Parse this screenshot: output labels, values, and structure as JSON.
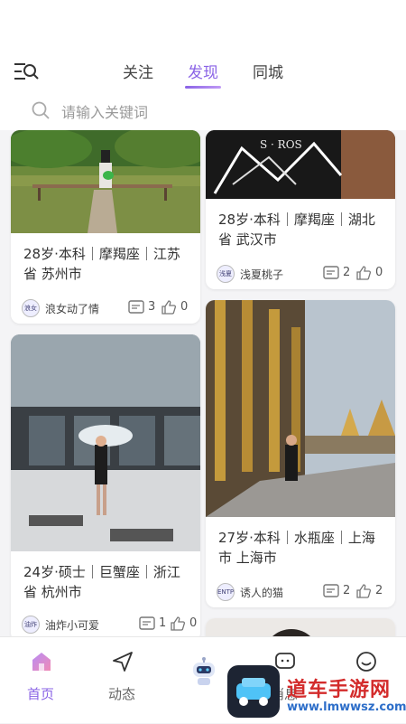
{
  "header": {
    "tabs": [
      {
        "label": "关注",
        "active": false
      },
      {
        "label": "发现",
        "active": true
      },
      {
        "label": "同城",
        "active": false
      }
    ],
    "menu_icon": "menu-search-icon"
  },
  "search": {
    "placeholder": "请输入关键词",
    "icon": "search-icon"
  },
  "cards": [
    {
      "info_line1": "28岁·本科｜摩羯座｜江苏",
      "info_line2": "省 苏州市",
      "avatar_text": "浪女",
      "username": "浪女动了情",
      "comments": "3",
      "likes": "0"
    },
    {
      "info_line1": "28岁·本科｜摩羯座｜湖北",
      "info_line2": "省 武汉市",
      "avatar_text": "浅夏",
      "username": "浅夏桃子",
      "comments": "2",
      "likes": "0"
    },
    {
      "info_line1": "24岁·硕士｜巨蟹座｜浙江",
      "info_line2": "省 杭州市",
      "avatar_text": "油炸",
      "username": "油炸小可爱",
      "comments": "1",
      "likes": "0"
    },
    {
      "info_line1": "27岁·本科｜水瓶座｜上海",
      "info_line2": "市 上海市",
      "avatar_text": "ENTP",
      "username": "诱人的猫",
      "comments": "2",
      "likes": "2"
    }
  ],
  "bottom_nav": [
    {
      "label": "首页",
      "icon": "home-icon",
      "active": true
    },
    {
      "label": "动态",
      "icon": "send-icon",
      "active": false
    },
    {
      "label": "",
      "icon": "robot-icon",
      "active": false
    },
    {
      "label": "消息",
      "icon": "message-icon",
      "active": false
    },
    {
      "label": "",
      "icon": "profile-icon",
      "active": false
    }
  ],
  "watermark": {
    "title": "道车手游网",
    "url": "www.lmwwsz.com"
  },
  "colors": {
    "accent": "#8a63e6",
    "background": "#f4f4f6"
  }
}
